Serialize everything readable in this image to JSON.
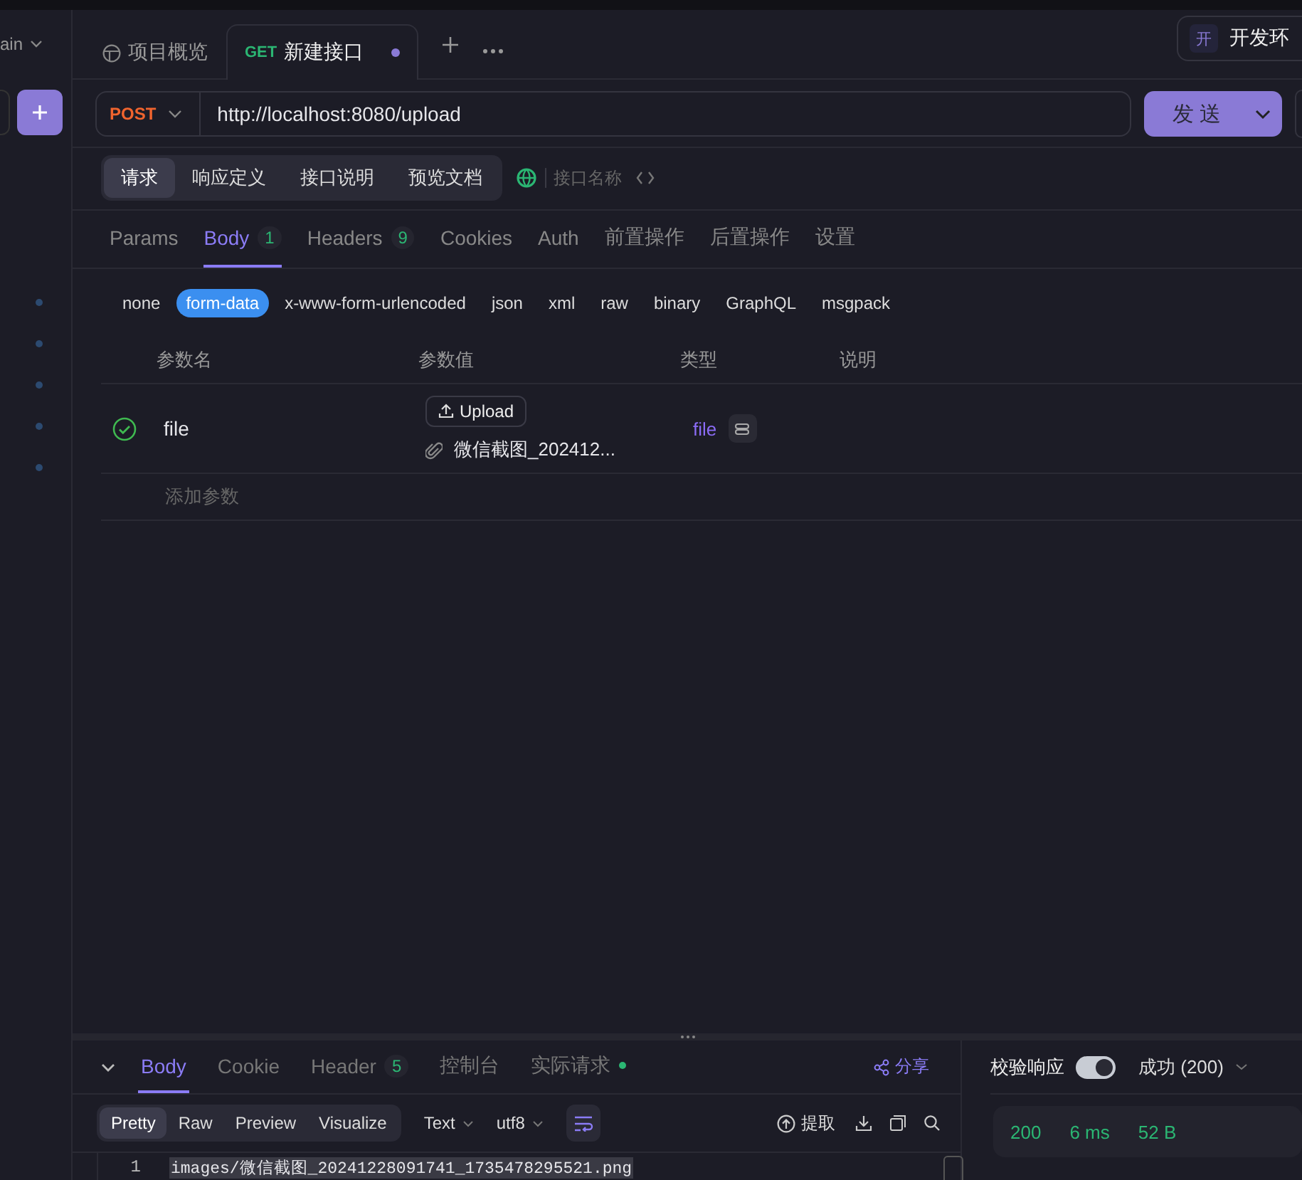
{
  "sidebar": {
    "branch": "ain"
  },
  "tabs": [
    {
      "kind": "overview",
      "label": "项目概览",
      "selected": false
    },
    {
      "kind": "request",
      "method": "GET",
      "label": "新建接口",
      "selected": true,
      "unsaved": true
    }
  ],
  "environment": {
    "badge": "开",
    "label": "开发环"
  },
  "request": {
    "method": "POST",
    "url": "http://localhost:8080/upload",
    "send_label": "发 送"
  },
  "modes": [
    {
      "label": "请求",
      "selected": true
    },
    {
      "label": "响应定义",
      "selected": false
    },
    {
      "label": "接口说明",
      "selected": false
    },
    {
      "label": "预览文档",
      "selected": false
    }
  ],
  "name_placeholder": "接口名称",
  "param_tabs": [
    {
      "label": "Params",
      "selected": false
    },
    {
      "label": "Body",
      "count": "1",
      "selected": true
    },
    {
      "label": "Headers",
      "count": "9",
      "selected": false
    },
    {
      "label": "Cookies",
      "selected": false
    },
    {
      "label": "Auth",
      "selected": false
    },
    {
      "label": "前置操作",
      "selected": false
    },
    {
      "label": "后置操作",
      "selected": false
    },
    {
      "label": "设置",
      "selected": false
    }
  ],
  "body_types": [
    {
      "label": "none",
      "selected": false
    },
    {
      "label": "form-data",
      "selected": true
    },
    {
      "label": "x-www-form-urlencoded",
      "selected": false
    },
    {
      "label": "json",
      "selected": false
    },
    {
      "label": "xml",
      "selected": false
    },
    {
      "label": "raw",
      "selected": false
    },
    {
      "label": "binary",
      "selected": false
    },
    {
      "label": "GraphQL",
      "selected": false
    },
    {
      "label": "msgpack",
      "selected": false
    }
  ],
  "table": {
    "columns": [
      "参数名",
      "参数值",
      "类型",
      "说明"
    ],
    "rows": [
      {
        "enabled": true,
        "name": "file",
        "upload_label": "Upload",
        "file_name": "微信截图_202412...",
        "type": "file"
      }
    ],
    "add_placeholder": "添加参数"
  },
  "response": {
    "tabs": [
      {
        "label": "Body",
        "selected": true
      },
      {
        "label": "Cookie",
        "selected": false
      },
      {
        "label": "Header",
        "count": "5",
        "selected": false
      },
      {
        "label": "控制台",
        "selected": false
      },
      {
        "label": "实际请求",
        "dot": true,
        "selected": false
      }
    ],
    "share": "分享",
    "validate": {
      "label": "校验响应",
      "on": true
    },
    "status_select": "成功 (200)",
    "views": [
      {
        "label": "Pretty",
        "selected": true
      },
      {
        "label": "Raw",
        "selected": false
      },
      {
        "label": "Preview",
        "selected": false
      },
      {
        "label": "Visualize",
        "selected": false
      }
    ],
    "format": "Text",
    "encoding": "utf8",
    "extract": "提取",
    "status": {
      "code": "200",
      "time": "6 ms",
      "size": "52 B"
    },
    "lines": [
      {
        "number": "1",
        "text": "images/微信截图_20241228091741_1735478295521.png",
        "selected": true
      }
    ]
  }
}
